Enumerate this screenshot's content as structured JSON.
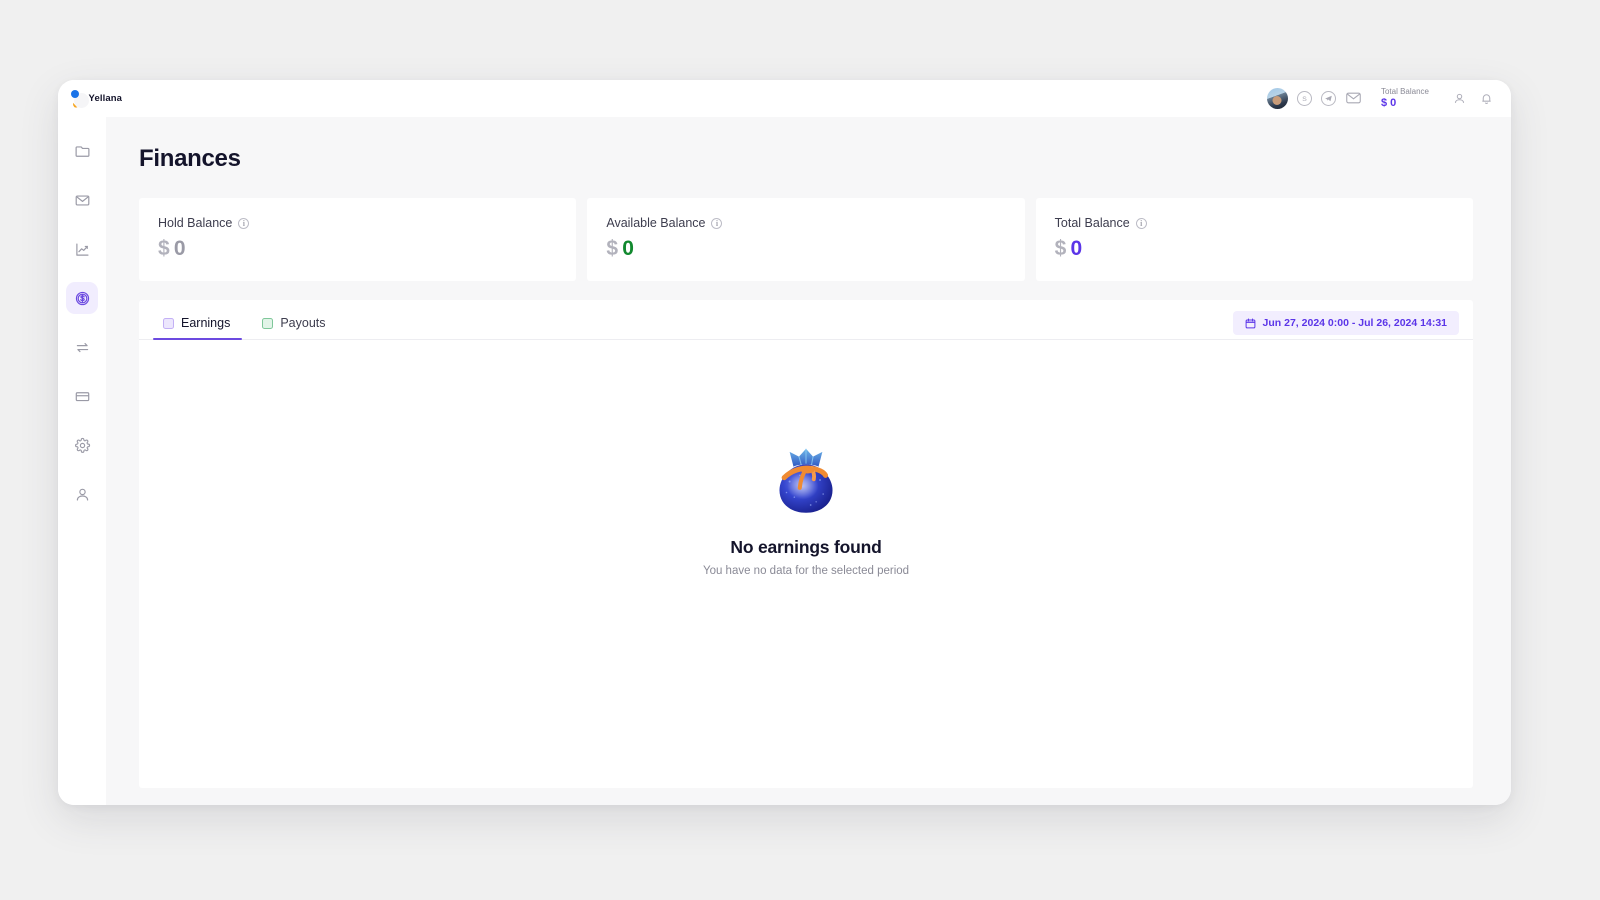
{
  "brand": {
    "name": "Yellana",
    "logo_icon": "crescent-dot-logo"
  },
  "header": {
    "avatar": "user-avatar",
    "icons": [
      {
        "name": "skype-icon",
        "glyph": "S"
      },
      {
        "name": "telegram-icon",
        "glyph": "paper-plane"
      },
      {
        "name": "mail-icon",
        "glyph": "envelope"
      }
    ],
    "balance": {
      "label": "Total Balance",
      "value": "$ 0",
      "color": "#5b35e8"
    },
    "account_icon": "user-icon",
    "notifications_icon": "bell-icon"
  },
  "sidebar": {
    "items": [
      {
        "name": "sidebar-item-projects",
        "icon": "folder-icon",
        "active": false
      },
      {
        "name": "sidebar-item-messages",
        "icon": "envelope-icon",
        "active": false
      },
      {
        "name": "sidebar-item-statistics",
        "icon": "chart-icon",
        "active": false
      },
      {
        "name": "sidebar-item-finances",
        "icon": "dollar-coin-icon",
        "active": true
      },
      {
        "name": "sidebar-item-transfers",
        "icon": "swap-arrows-icon",
        "active": false
      },
      {
        "name": "sidebar-item-cards",
        "icon": "credit-card-icon",
        "active": false
      },
      {
        "name": "sidebar-item-settings",
        "icon": "gear-icon",
        "active": false
      },
      {
        "name": "sidebar-item-profile",
        "icon": "person-icon",
        "active": false
      }
    ]
  },
  "main": {
    "page_title": "Finances",
    "cards": [
      {
        "label": "Hold Balance",
        "currency": "$",
        "value": "0",
        "value_color": "#9a9aa6",
        "info": "info-icon"
      },
      {
        "label": "Available Balance",
        "currency": "$",
        "value": "0",
        "value_color": "#12892f",
        "info": "info-icon"
      },
      {
        "label": "Total Balance",
        "currency": "$",
        "value": "0",
        "value_color": "#5b35e8",
        "info": "info-icon"
      }
    ],
    "tabs": [
      {
        "label": "Earnings",
        "swatch": "#c3b0f5",
        "active": true
      },
      {
        "label": "Payouts",
        "swatch": "#7fc79a",
        "active": false
      }
    ],
    "date_range": {
      "icon": "calendar-icon",
      "text": "Jun 27, 2024 0:00 - Jul 26, 2024 14:31"
    },
    "empty_state": {
      "illustration": "money-bag-illustration",
      "title": "No earnings found",
      "subtitle": "You have no data for the selected period"
    }
  }
}
